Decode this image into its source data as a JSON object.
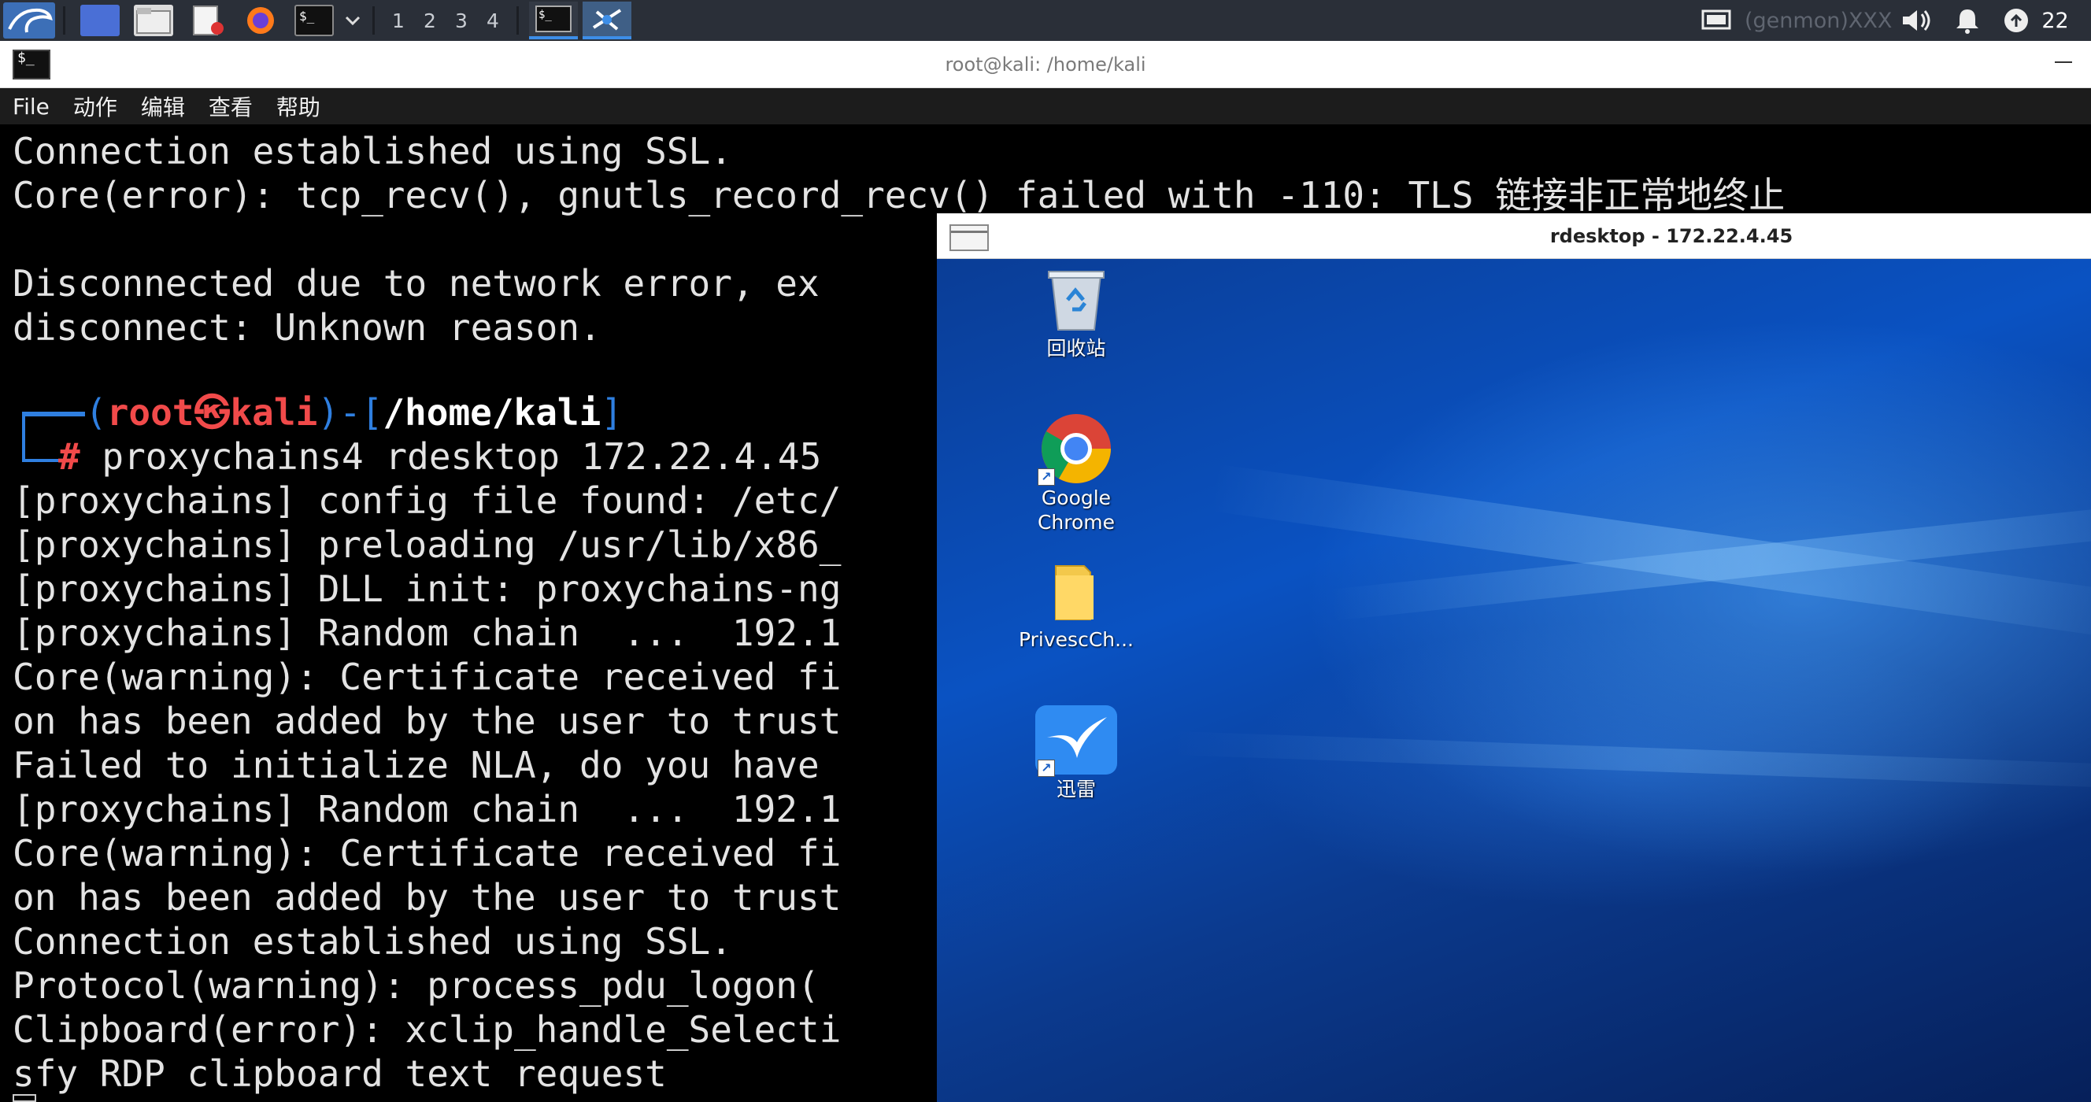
{
  "panel": {
    "workspaces": [
      "1",
      "2",
      "3",
      "4"
    ],
    "genmon_text": "(genmon)XXX",
    "clock": "22"
  },
  "terminal": {
    "title": "root@kali: /home/kali",
    "menu": [
      "File",
      "动作",
      "编辑",
      "查看",
      "帮助"
    ],
    "lines": [
      "Connection established using SSL.",
      "Core(error): tcp_recv(), gnutls_record_recv() failed with -110: TLS 链接非正常地终止",
      "",
      "Disconnected due to network error, ex",
      "disconnect: Unknown reason.",
      "",
      "",
      "",
      "[proxychains] config file found: /etc/",
      "[proxychains] preloading /usr/lib/x86_",
      "[proxychains] DLL init: proxychains-ng",
      "[proxychains] Random chain  ...  192.1",
      "Core(warning): Certificate received fi",
      "on has been added by the user to trust",
      "Failed to initialize NLA, do you have",
      "[proxychains] Random chain  ...  192.1",
      "Core(warning): Certificate received fi",
      "on has been added by the user to trust",
      "Connection established using SSL.",
      "Protocol(warning): process_pdu_logon(",
      "Clipboard(error): xclip_handle_Selecti",
      "sfy RDP clipboard text request"
    ],
    "prompt": {
      "open": "(",
      "user": "root",
      "at": "㉿",
      "host": "kali",
      "mid": ")-[",
      "path": "/home/kali",
      "close": "]",
      "hash": "#",
      "command": " proxychains4 rdesktop 172.22.4.45"
    }
  },
  "rdp": {
    "title": "rdesktop - 172.22.4.45",
    "icons": [
      {
        "name": "recycle-bin",
        "label": "回收站"
      },
      {
        "name": "google-chrome",
        "label": "Google Chrome"
      },
      {
        "name": "privesc-folder",
        "label": "PrivescCh..."
      },
      {
        "name": "xunlei",
        "label": "迅雷"
      }
    ]
  },
  "colors": {
    "panel_bg": "#2a2f38",
    "prompt_blue": "#2f7fe0",
    "prompt_red": "#f14a4a",
    "desktop_blue": "#0a52c2"
  }
}
